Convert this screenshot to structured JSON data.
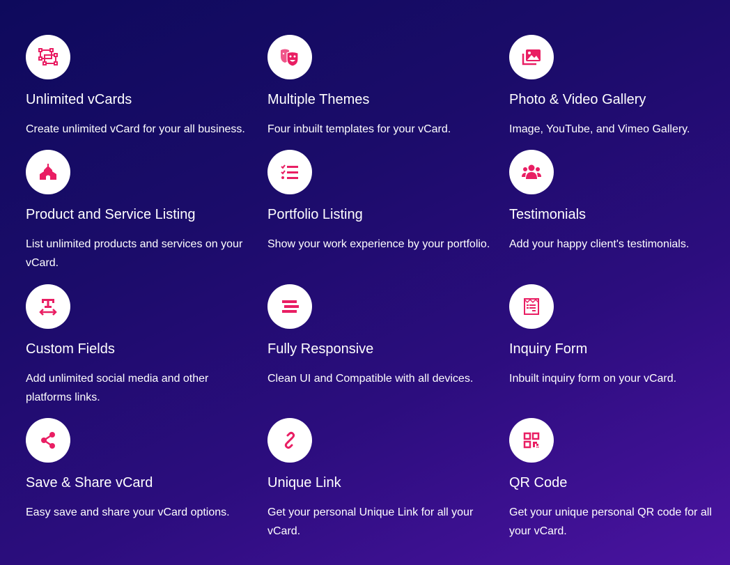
{
  "accent_color": "#e91e63",
  "features": [
    {
      "title": "Unlimited vCards",
      "description": "Create unlimited vCard for your all business.",
      "icon": "vector-square-icon"
    },
    {
      "title": "Multiple Themes",
      "description": "Four inbuilt templates for your vCard.",
      "icon": "theater-masks-icon"
    },
    {
      "title": "Photo & Video Gallery",
      "description": "Image, YouTube, and Vimeo Gallery.",
      "icon": "images-icon"
    },
    {
      "title": "Product and Service Listing",
      "description": "List unlimited products and services on your vCard.",
      "icon": "building-icon"
    },
    {
      "title": "Portfolio Listing",
      "description": "Show your work experience by your portfolio.",
      "icon": "tasks-list-icon"
    },
    {
      "title": "Testimonials",
      "description": "Add your happy client's testimonials.",
      "icon": "users-icon"
    },
    {
      "title": "Custom Fields",
      "description": "Add unlimited social media and other platforms links.",
      "icon": "text-width-icon"
    },
    {
      "title": "Fully Responsive",
      "description": "Clean UI and Compatible with all devices.",
      "icon": "stream-icon"
    },
    {
      "title": "Inquiry Form",
      "description": "Inbuilt inquiry form on your vCard.",
      "icon": "form-icon"
    },
    {
      "title": "Save & Share vCard",
      "description": "Easy save and share your vCard options.",
      "icon": "share-icon"
    },
    {
      "title": "Unique Link",
      "description": "Get your personal Unique Link for all your vCard.",
      "icon": "link-icon"
    },
    {
      "title": "QR Code",
      "description": "Get your unique personal QR code for all your vCard.",
      "icon": "qr-code-icon"
    }
  ]
}
